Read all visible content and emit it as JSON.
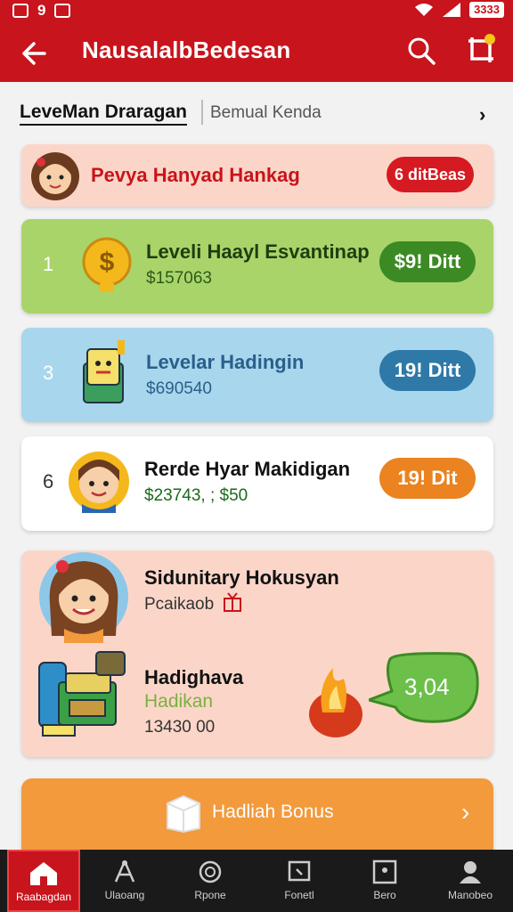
{
  "status_bar": {
    "left_text": "9",
    "battery": "3333"
  },
  "app_bar": {
    "title": "NausalalbBedesan"
  },
  "tabs": {
    "active": "LeveMan Draragan",
    "other": "Bemual Kenda"
  },
  "header_card": {
    "title": "Pevya Hanyad Hankag",
    "badge": "6 ditBeas"
  },
  "rows": [
    {
      "rank": "1",
      "title": "Leveli Haayl Esvantinap",
      "sub": "$157063",
      "pill": "$9! Ditt",
      "pill_color": "#3c8a24"
    },
    {
      "rank": "3",
      "title": "Levelar Hadingin",
      "sub": "$690540",
      "pill": "19! Ditt",
      "pill_color": "#2e79a8"
    },
    {
      "rank": "6",
      "title": "Rerde Hyar Makidigan",
      "sub": "$23743, ; $50",
      "pill": "19! Dit",
      "pill_color": "#ea8320"
    }
  ],
  "big_card": {
    "title": "Sidunitary Hokusyan",
    "sub": "Pcaikaob",
    "item_title": "Hadighava",
    "item_sub": "Hadikan",
    "item_value": "13430 00",
    "bubble": "3,04"
  },
  "bonus_button": {
    "label": "Hadliah Bonus"
  },
  "bottom_nav": [
    {
      "label": "Raabagdan",
      "icon": "home-icon"
    },
    {
      "label": "Ulaoang",
      "icon": "person-tree-icon"
    },
    {
      "label": "Rpone",
      "icon": "circle-icon"
    },
    {
      "label": "Fonetl",
      "icon": "frame-icon"
    },
    {
      "label": "Bero",
      "icon": "square-dot-icon"
    },
    {
      "label": "Manobeo",
      "icon": "user-icon"
    }
  ],
  "colors": {
    "primary_red": "#c8141c",
    "green": "#a9d46a",
    "blue": "#a8d6ec",
    "orange": "#f29a3c",
    "peach": "#fbd6c8"
  }
}
